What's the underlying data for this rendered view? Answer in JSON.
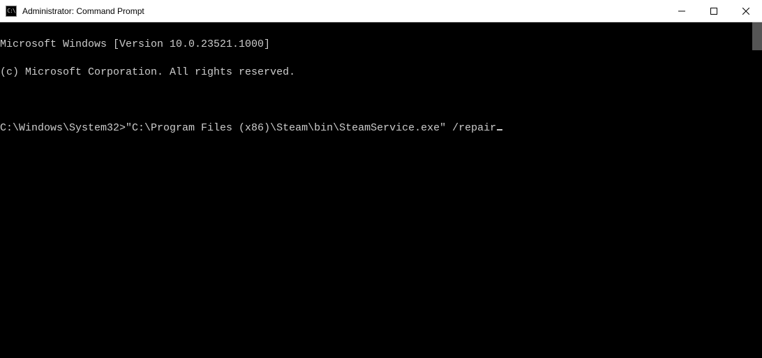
{
  "window": {
    "title": "Administrator: Command Prompt",
    "icon_text": "C:\\"
  },
  "terminal": {
    "header_line1": "Microsoft Windows [Version 10.0.23521.1000]",
    "header_line2": "(c) Microsoft Corporation. All rights reserved.",
    "prompt": "C:\\Windows\\System32>",
    "command": "\"C:\\Program Files (x86)\\Steam\\bin\\SteamService.exe\" /repair"
  }
}
